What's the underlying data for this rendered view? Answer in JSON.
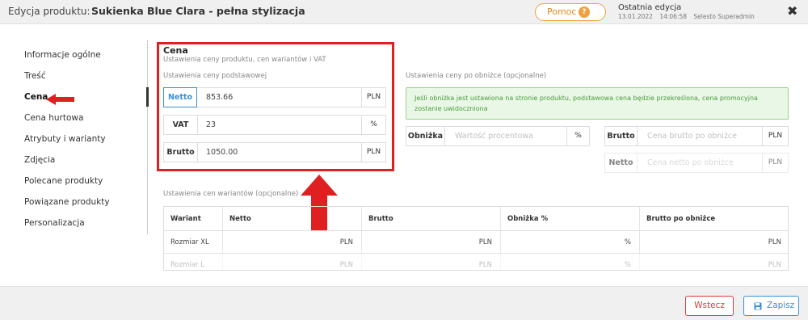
{
  "header": {
    "label": "Edycja produktu:",
    "title": "Sukienka Blue Clara - pełna stylizacja",
    "help_label": "Pomoc",
    "help_icon": "?",
    "last_edit_title": "Ostatnia edycja",
    "last_edit_date": "13.01.2022",
    "last_edit_time": "14:06:58",
    "last_edit_user": "Selesto Superadmin",
    "close_icon": "✖"
  },
  "sidebar": {
    "items": [
      {
        "label": "Informacje ogólne"
      },
      {
        "label": "Treść"
      },
      {
        "label": "Cena"
      },
      {
        "label": "Cena hurtowa"
      },
      {
        "label": "Atrybuty i warianty"
      },
      {
        "label": "Zdjęcia"
      },
      {
        "label": "Polecane produkty"
      },
      {
        "label": "Powiązane produkty"
      },
      {
        "label": "Personalizacja"
      }
    ]
  },
  "price": {
    "title": "Cena",
    "subtitle": "Ustawienia ceny produktu, cen wariantów i VAT",
    "base_label": "Ustawienia ceny podstawowej",
    "netto_label": "Netto",
    "netto_value": "853.66",
    "netto_unit": "PLN",
    "vat_label": "VAT",
    "vat_value": "23",
    "vat_unit": "%",
    "brutto_label": "Brutto",
    "brutto_value": "1050.00",
    "brutto_unit": "PLN"
  },
  "discount": {
    "label": "Ustawienia ceny po obniżce (opcjonalne)",
    "alert": "Jeśli obniżka jest ustawiona na stronie produktu, podstawowa cena będzie przekreślona, cena promocyjna zostanie uwidoczniona",
    "obnizka_label": "Obniżka",
    "obnizka_placeholder": "Wartość procentowa",
    "obnizka_unit": "%",
    "brutto_label": "Brutto",
    "brutto_placeholder": "Cena brutto po obniżce",
    "brutto_unit": "PLN",
    "netto_label": "Netto",
    "netto_placeholder": "Cena netto po obniżce",
    "netto_unit": "PLN"
  },
  "variants": {
    "label": "Ustawienia cen wariantów (opcjonalne)",
    "headers": [
      "Wariant",
      "Netto",
      "Brutto",
      "Obniżka %",
      "Brutto po obniżce"
    ],
    "rows": [
      {
        "name": "Rozmiar XL",
        "netto": "PLN",
        "brutto": "PLN",
        "obnizka": "%",
        "brutto_po": "PLN"
      },
      {
        "name": "Rozmiar L",
        "netto": "PLN",
        "brutto": "PLN",
        "obnizka": "%",
        "brutto_po": "PLN"
      }
    ]
  },
  "footer": {
    "back_label": "Wstecz",
    "save_label": "Zapisz"
  },
  "colors": {
    "accent_blue": "#3a8fd6",
    "alert_red": "#e02020",
    "help_orange": "#f0a040",
    "success_green": "#4a9a3c"
  }
}
